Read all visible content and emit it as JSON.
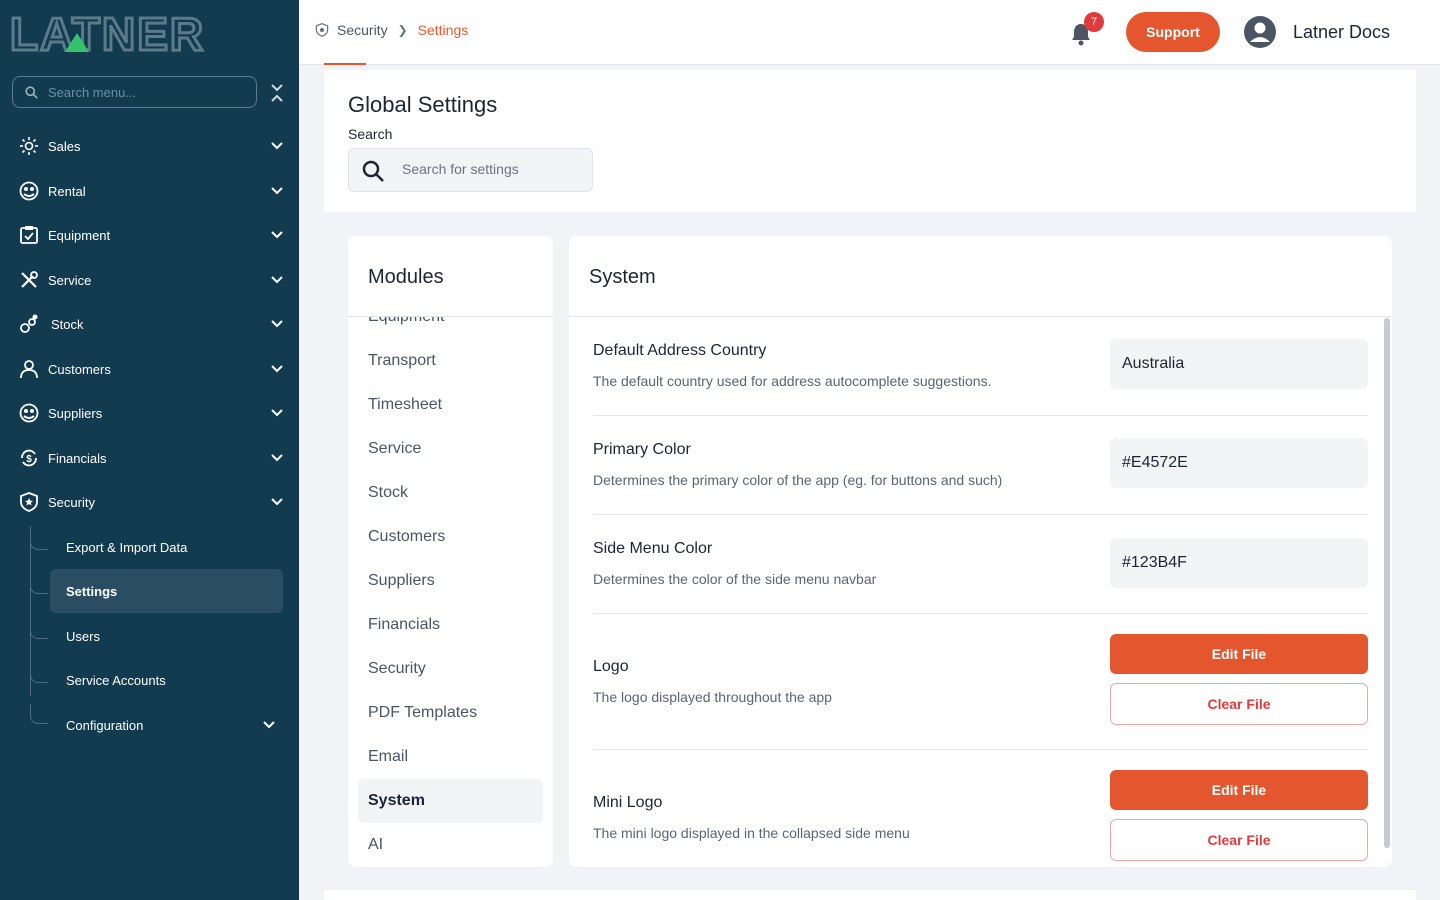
{
  "app": {
    "logo_text": "LATNER",
    "brand_color": "#E4572E",
    "sidebar_color": "#123B4F"
  },
  "sidebar": {
    "search_placeholder": "Search menu...",
    "items": [
      {
        "label": "Sales",
        "icon": "sales-icon"
      },
      {
        "label": "Rental",
        "icon": "rental-icon"
      },
      {
        "label": "Equipment",
        "icon": "equipment-icon"
      },
      {
        "label": "Service",
        "icon": "service-icon"
      },
      {
        "label": "Stock",
        "icon": "stock-icon"
      },
      {
        "label": "Customers",
        "icon": "customers-icon"
      },
      {
        "label": "Suppliers",
        "icon": "suppliers-icon"
      },
      {
        "label": "Financials",
        "icon": "financials-icon"
      },
      {
        "label": "Security",
        "icon": "security-icon"
      }
    ],
    "security_children": [
      {
        "label": "Export & Import Data"
      },
      {
        "label": "Settings",
        "active": true
      },
      {
        "label": "Users"
      },
      {
        "label": "Service Accounts"
      },
      {
        "label": "Configuration"
      }
    ]
  },
  "topbar": {
    "breadcrumb": [
      "Security",
      "Settings"
    ],
    "notification_count": "7",
    "support_label": "Support",
    "user_name": "Latner Docs"
  },
  "header": {
    "title": "Global Settings",
    "search_label": "Search",
    "search_placeholder": "Search for settings"
  },
  "modules": {
    "title": "Modules",
    "items": [
      {
        "label": "Equipment"
      },
      {
        "label": "Transport"
      },
      {
        "label": "Timesheet"
      },
      {
        "label": "Service"
      },
      {
        "label": "Stock"
      },
      {
        "label": "Customers"
      },
      {
        "label": "Suppliers"
      },
      {
        "label": "Financials"
      },
      {
        "label": "Security"
      },
      {
        "label": "PDF Templates"
      },
      {
        "label": "Email"
      },
      {
        "label": "System",
        "active": true
      },
      {
        "label": "AI"
      }
    ]
  },
  "system": {
    "title": "System",
    "settings": [
      {
        "title": "Default Address Country",
        "description": "The default country used for address autocomplete suggestions.",
        "value": "Australia"
      },
      {
        "title": "Primary Color",
        "description": "Determines the primary color of the app (eg. for buttons and such)",
        "value": "#E4572E"
      },
      {
        "title": "Side Menu Color",
        "description": "Determines the color of the side menu navbar",
        "value": "#123B4F"
      },
      {
        "title": "Logo",
        "description": "The logo displayed throughout the app",
        "edit_label": "Edit File",
        "clear_label": "Clear File"
      },
      {
        "title": "Mini Logo",
        "description": "The mini logo displayed in the collapsed side menu",
        "edit_label": "Edit File",
        "clear_label": "Clear File"
      }
    ]
  }
}
